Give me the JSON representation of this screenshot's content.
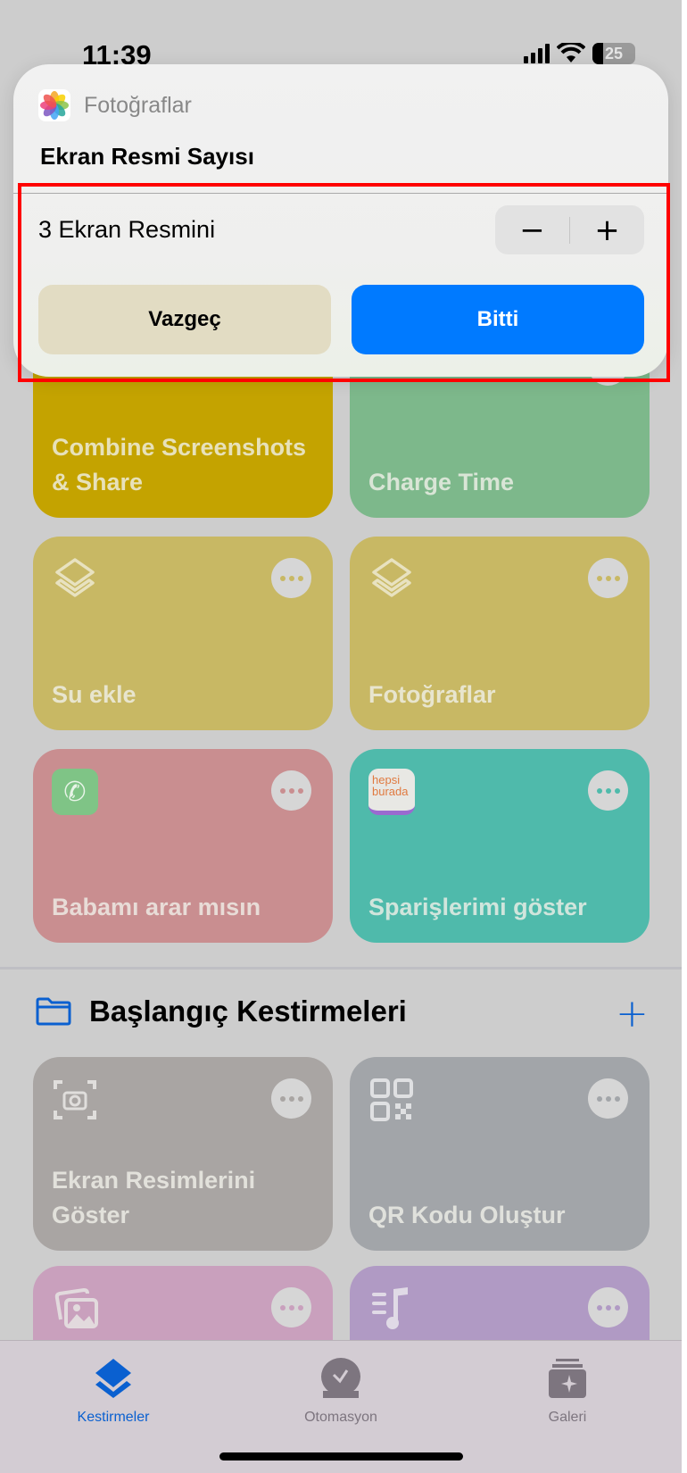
{
  "status_bar": {
    "time": "11:39",
    "battery": "25"
  },
  "dialog": {
    "app_name": "Fotoğraflar",
    "title": "Ekran Resmi Sayısı",
    "value_text": "3 Ekran Resmini",
    "stepper": {
      "minus": "−",
      "plus": "+"
    },
    "cancel_label": "Vazgeç",
    "done_label": "Bitti"
  },
  "shortcuts": [
    {
      "label": "Combine Screenshots & Share",
      "color": "#c4a300",
      "icon": "screenshot-icon"
    },
    {
      "label": "Charge Time",
      "color": "#7db88b",
      "icon": "shortcut-icon"
    },
    {
      "label": "Su ekle",
      "color": "#c8b864",
      "icon": "layers-icon"
    },
    {
      "label": "Fotoğraflar",
      "color": "#c8b864",
      "icon": "layers-icon"
    },
    {
      "label": "Babamı arar mısın",
      "color": "#c98e90",
      "icon": "phone-app-icon"
    },
    {
      "label": "Sparişlerimi göster",
      "color": "#4fbaab",
      "icon": "hepsiburada-app-icon",
      "icon_text": "hepsi burada"
    }
  ],
  "section": {
    "title": "Başlangıç Kestirmeleri",
    "add": "+"
  },
  "starter_shortcuts": [
    {
      "label": "Ekran Resimlerini Göster",
      "color": "#a9a5a3",
      "icon": "camera-viewfinder-icon"
    },
    {
      "label": "QR Kodu Oluştur",
      "color": "#a2a5a9",
      "icon": "qr-code-icon"
    },
    {
      "label": "",
      "color": "#c9a0bd",
      "icon": "photos-stack-icon"
    },
    {
      "label": "",
      "color": "#b09ac4",
      "icon": "music-list-icon"
    }
  ],
  "tabs": [
    {
      "label": "Kestirmeler",
      "active": true
    },
    {
      "label": "Otomasyon",
      "active": false
    },
    {
      "label": "Galeri",
      "active": false
    }
  ],
  "colors": {
    "accent": "#007aff",
    "tab_active": "#0a60d0",
    "tab_inactive": "#7d757f"
  }
}
